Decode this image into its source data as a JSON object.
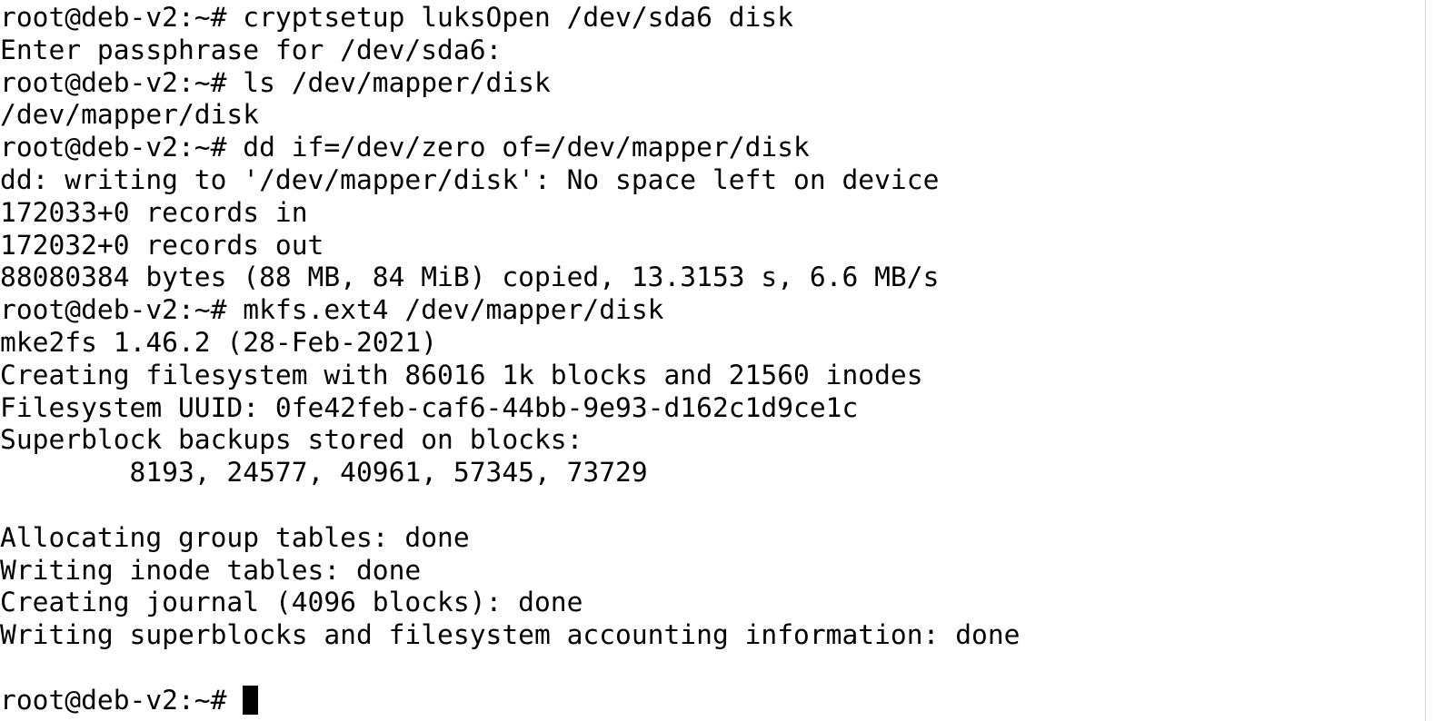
{
  "terminal": {
    "colors": {
      "background": "#ffffff",
      "foreground": "#000000",
      "cursor": "#000000"
    },
    "lines": [
      "root@deb-v2:~# cryptsetup luksOpen /dev/sda6 disk",
      "Enter passphrase for /dev/sda6:",
      "root@deb-v2:~# ls /dev/mapper/disk",
      "/dev/mapper/disk",
      "root@deb-v2:~# dd if=/dev/zero of=/dev/mapper/disk",
      "dd: writing to '/dev/mapper/disk': No space left on device",
      "172033+0 records in",
      "172032+0 records out",
      "88080384 bytes (88 MB, 84 MiB) copied, 13.3153 s, 6.6 MB/s",
      "root@deb-v2:~# mkfs.ext4 /dev/mapper/disk",
      "mke2fs 1.46.2 (28-Feb-2021)",
      "Creating filesystem with 86016 1k blocks and 21560 inodes",
      "Filesystem UUID: 0fe42feb-caf6-44bb-9e93-d162c1d9ce1c",
      "Superblock backups stored on blocks:",
      "        8193, 24577, 40961, 57345, 73729",
      "",
      "Allocating group tables: done",
      "Writing inode tables: done",
      "Creating journal (4096 blocks): done",
      "Writing superblocks and filesystem accounting information: done",
      "",
      "root@deb-v2:~# "
    ],
    "prompt": "root@deb-v2:~# "
  }
}
